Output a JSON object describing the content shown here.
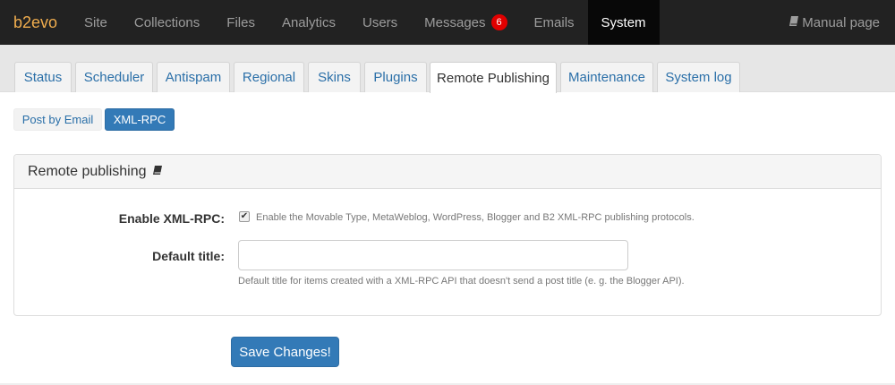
{
  "navbar": {
    "brand": "b2evo",
    "items": [
      {
        "label": "Site"
      },
      {
        "label": "Collections"
      },
      {
        "label": "Files"
      },
      {
        "label": "Analytics"
      },
      {
        "label": "Users"
      },
      {
        "label": "Messages",
        "badge": "6"
      },
      {
        "label": "Emails"
      },
      {
        "label": "System",
        "active": true
      }
    ],
    "manual_label": "Manual page",
    "manual_icon": "book-icon"
  },
  "tabs": [
    {
      "label": "Status"
    },
    {
      "label": "Scheduler"
    },
    {
      "label": "Antispam"
    },
    {
      "label": "Regional"
    },
    {
      "label": "Skins"
    },
    {
      "label": "Plugins"
    },
    {
      "label": "Remote Publishing",
      "active": true
    },
    {
      "label": "Maintenance"
    },
    {
      "label": "System log"
    }
  ],
  "subtabs": [
    {
      "label": "Post by Email"
    },
    {
      "label": "XML-RPC",
      "active": true
    }
  ],
  "panel": {
    "title": "Remote publishing",
    "title_icon": "book-icon",
    "enable_xmlrpc": {
      "label": "Enable XML-RPC:",
      "checked": true,
      "note": "Enable the Movable Type, MetaWeblog, WordPress, Blogger and B2 XML-RPC publishing protocols."
    },
    "default_title": {
      "label": "Default title:",
      "value": "",
      "help": "Default title for items created with a XML-RPC API that doesn't send a post title (e. g. the Blogger API)."
    }
  },
  "save_label": "Save Changes!",
  "colors": {
    "brand": "#f0ad4e",
    "primary": "#337ab7",
    "badge": "#e10000",
    "navbar": "#222222"
  }
}
